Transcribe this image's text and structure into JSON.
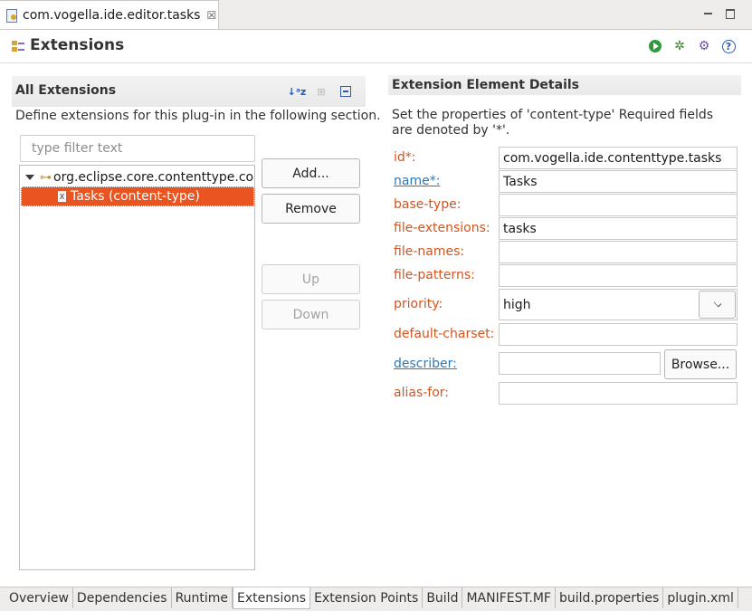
{
  "editor_tab": {
    "title": "com.vogella.ide.editor.tasks",
    "close_glyph": "☒"
  },
  "header": {
    "title": "Extensions"
  },
  "all_extensions": {
    "title": "All Extensions",
    "description": "Define extensions for this plug-in in the following section.",
    "filter_placeholder": "type filter text",
    "tree": {
      "parent_label": "org.eclipse.core.contenttype.contentTypes",
      "child_label": "Tasks (content-type)"
    },
    "buttons": {
      "add": "Add...",
      "remove": "Remove",
      "up": "Up",
      "down": "Down"
    }
  },
  "details": {
    "title": "Extension Element Details",
    "description": "Set the properties of 'content-type' Required fields are denoted by '*'.",
    "fields": {
      "id": {
        "label": "id*:",
        "value": "com.vogella.ide.contenttype.tasks"
      },
      "name": {
        "label": "name*:",
        "value": "Tasks"
      },
      "base_type": {
        "label": "base-type:",
        "value": ""
      },
      "file_extensions": {
        "label": "file-extensions:",
        "value": "tasks"
      },
      "file_names": {
        "label": "file-names:",
        "value": ""
      },
      "file_patterns": {
        "label": "file-patterns:",
        "value": ""
      },
      "priority": {
        "label": "priority:",
        "value": "high"
      },
      "default_charset": {
        "label": "default-charset:",
        "value": ""
      },
      "describer": {
        "label": "describer:",
        "value": "",
        "browse": "Browse..."
      },
      "alias_for": {
        "label": "alias-for:",
        "value": ""
      }
    }
  },
  "page_tabs": [
    "Overview",
    "Dependencies",
    "Runtime",
    "Extensions",
    "Extension Points",
    "Build",
    "MANIFEST.MF",
    "build.properties",
    "plugin.xml"
  ],
  "active_page_tab": "Extensions",
  "icons": {
    "editor_tab": "plugin-file-icon",
    "header": "extensions-icon",
    "run": "run-icon",
    "debug": "debug-icon",
    "help": "help-icon"
  },
  "colors": {
    "selection": "#e95420",
    "required_label": "#d4541e",
    "link_label": "#2a7ab8"
  }
}
